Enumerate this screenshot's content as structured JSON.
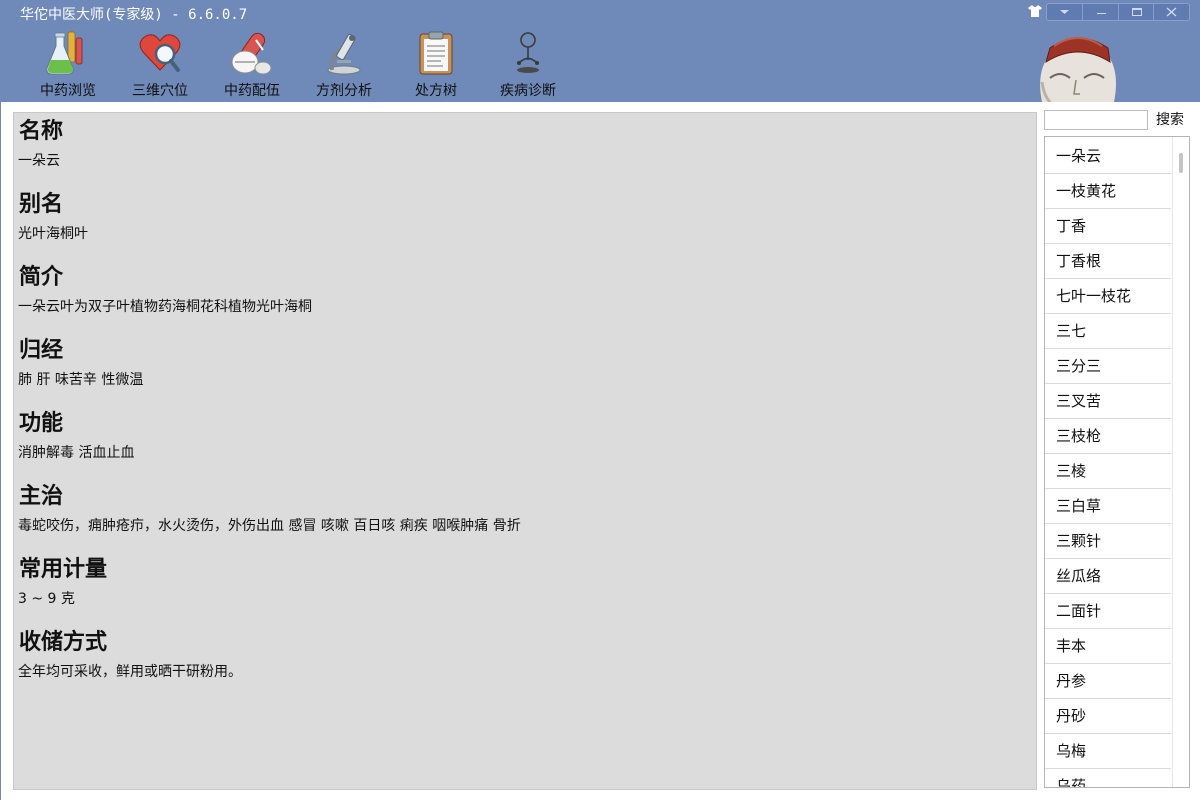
{
  "window": {
    "title": "华佗中医大师(专家级) - 6.6.0.7",
    "skin_icon": "shirt-icon",
    "controls": [
      "settings-icon",
      "minimize-icon",
      "maximize-icon",
      "close-icon"
    ]
  },
  "toolbar": {
    "items": [
      {
        "label": "中药浏览",
        "icon": "flask-icon"
      },
      {
        "label": "三维穴位",
        "icon": "heart-magnifier-icon"
      },
      {
        "label": "中药配伍",
        "icon": "pills-icon"
      },
      {
        "label": "方剂分析",
        "icon": "microscope-icon"
      },
      {
        "label": "处方树",
        "icon": "clipboard-icon"
      },
      {
        "label": "疾病诊断",
        "icon": "stethoscope-icon"
      }
    ]
  },
  "detail": {
    "sections": [
      {
        "title": "名称",
        "body": "一朵云"
      },
      {
        "title": "别名",
        "body": "光叶海桐叶"
      },
      {
        "title": "简介",
        "body": "一朵云叶为双子叶植物药海桐花科植物光叶海桐"
      },
      {
        "title": "归经",
        "body": "肺 肝 味苦辛 性微温"
      },
      {
        "title": "功能",
        "body": "消肿解毒 活血止血"
      },
      {
        "title": "主治",
        "body": "毒蛇咬伤，痈肿疮疖，水火烫伤，外伤出血 感冒 咳嗽 百日咳 痢疾 咽喉肿痛 骨折"
      },
      {
        "title": "常用计量",
        "body": "3 ~ 9 克"
      },
      {
        "title": "收储方式",
        "body": "全年均可采收，鲜用或晒干研粉用。"
      }
    ]
  },
  "search": {
    "value": "",
    "button_label": "搜索"
  },
  "herb_list": {
    "items": [
      "一朵云",
      "一枝黄花",
      "丁香",
      "丁香根",
      "七叶一枝花",
      "三七",
      "三分三",
      "三叉苦",
      "三枝枪",
      "三棱",
      "三白草",
      "三颗针",
      "丝瓜络",
      "二面针",
      "丰本",
      "丹参",
      "丹砂",
      "乌梅",
      "乌药"
    ]
  }
}
